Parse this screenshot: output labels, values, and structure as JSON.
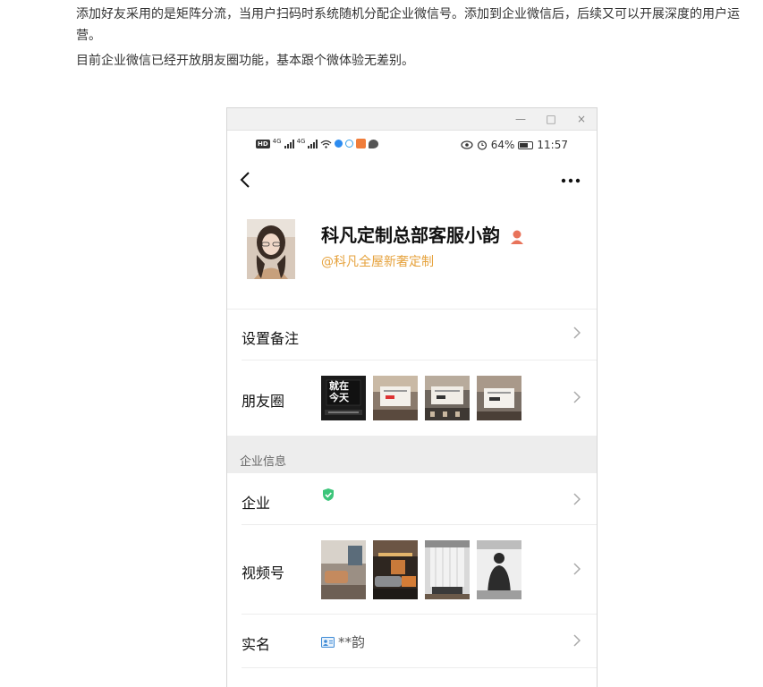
{
  "article": {
    "para1": "添加好友采用的是矩阵分流，当用户扫码时系统随机分配企业微信号。添加到企业微信后，后续又可以开展深度的用户运营。",
    "para2": "目前企业微信已经开放朋友圈功能，基本跟个微体验无差别。"
  },
  "window": {
    "minimize": "—",
    "maximize": "□",
    "close": "×"
  },
  "statusbar": {
    "hd": "HD",
    "net1": "4G",
    "net2": "4G",
    "battery": "64%",
    "time": "11:57"
  },
  "navbar": {
    "back": "‹",
    "more": "•••"
  },
  "profile": {
    "name": "科凡定制总部客服小韵",
    "company": "@科凡全屋新奢定制"
  },
  "rows": {
    "remark": "设置备注",
    "moments": "朋友圈",
    "enterprise": "企业",
    "channels": "视频号",
    "realname": "实名",
    "realname_value": "**韵"
  },
  "section": {
    "enterprise_info": "企业信息"
  },
  "moments_thumbs": {
    "first_text_a": "就在",
    "first_text_b": "今天"
  },
  "colors": {
    "accent_orange": "#e6a23c",
    "verified_green": "#3cc57a",
    "person_icon": "#e8735a"
  }
}
